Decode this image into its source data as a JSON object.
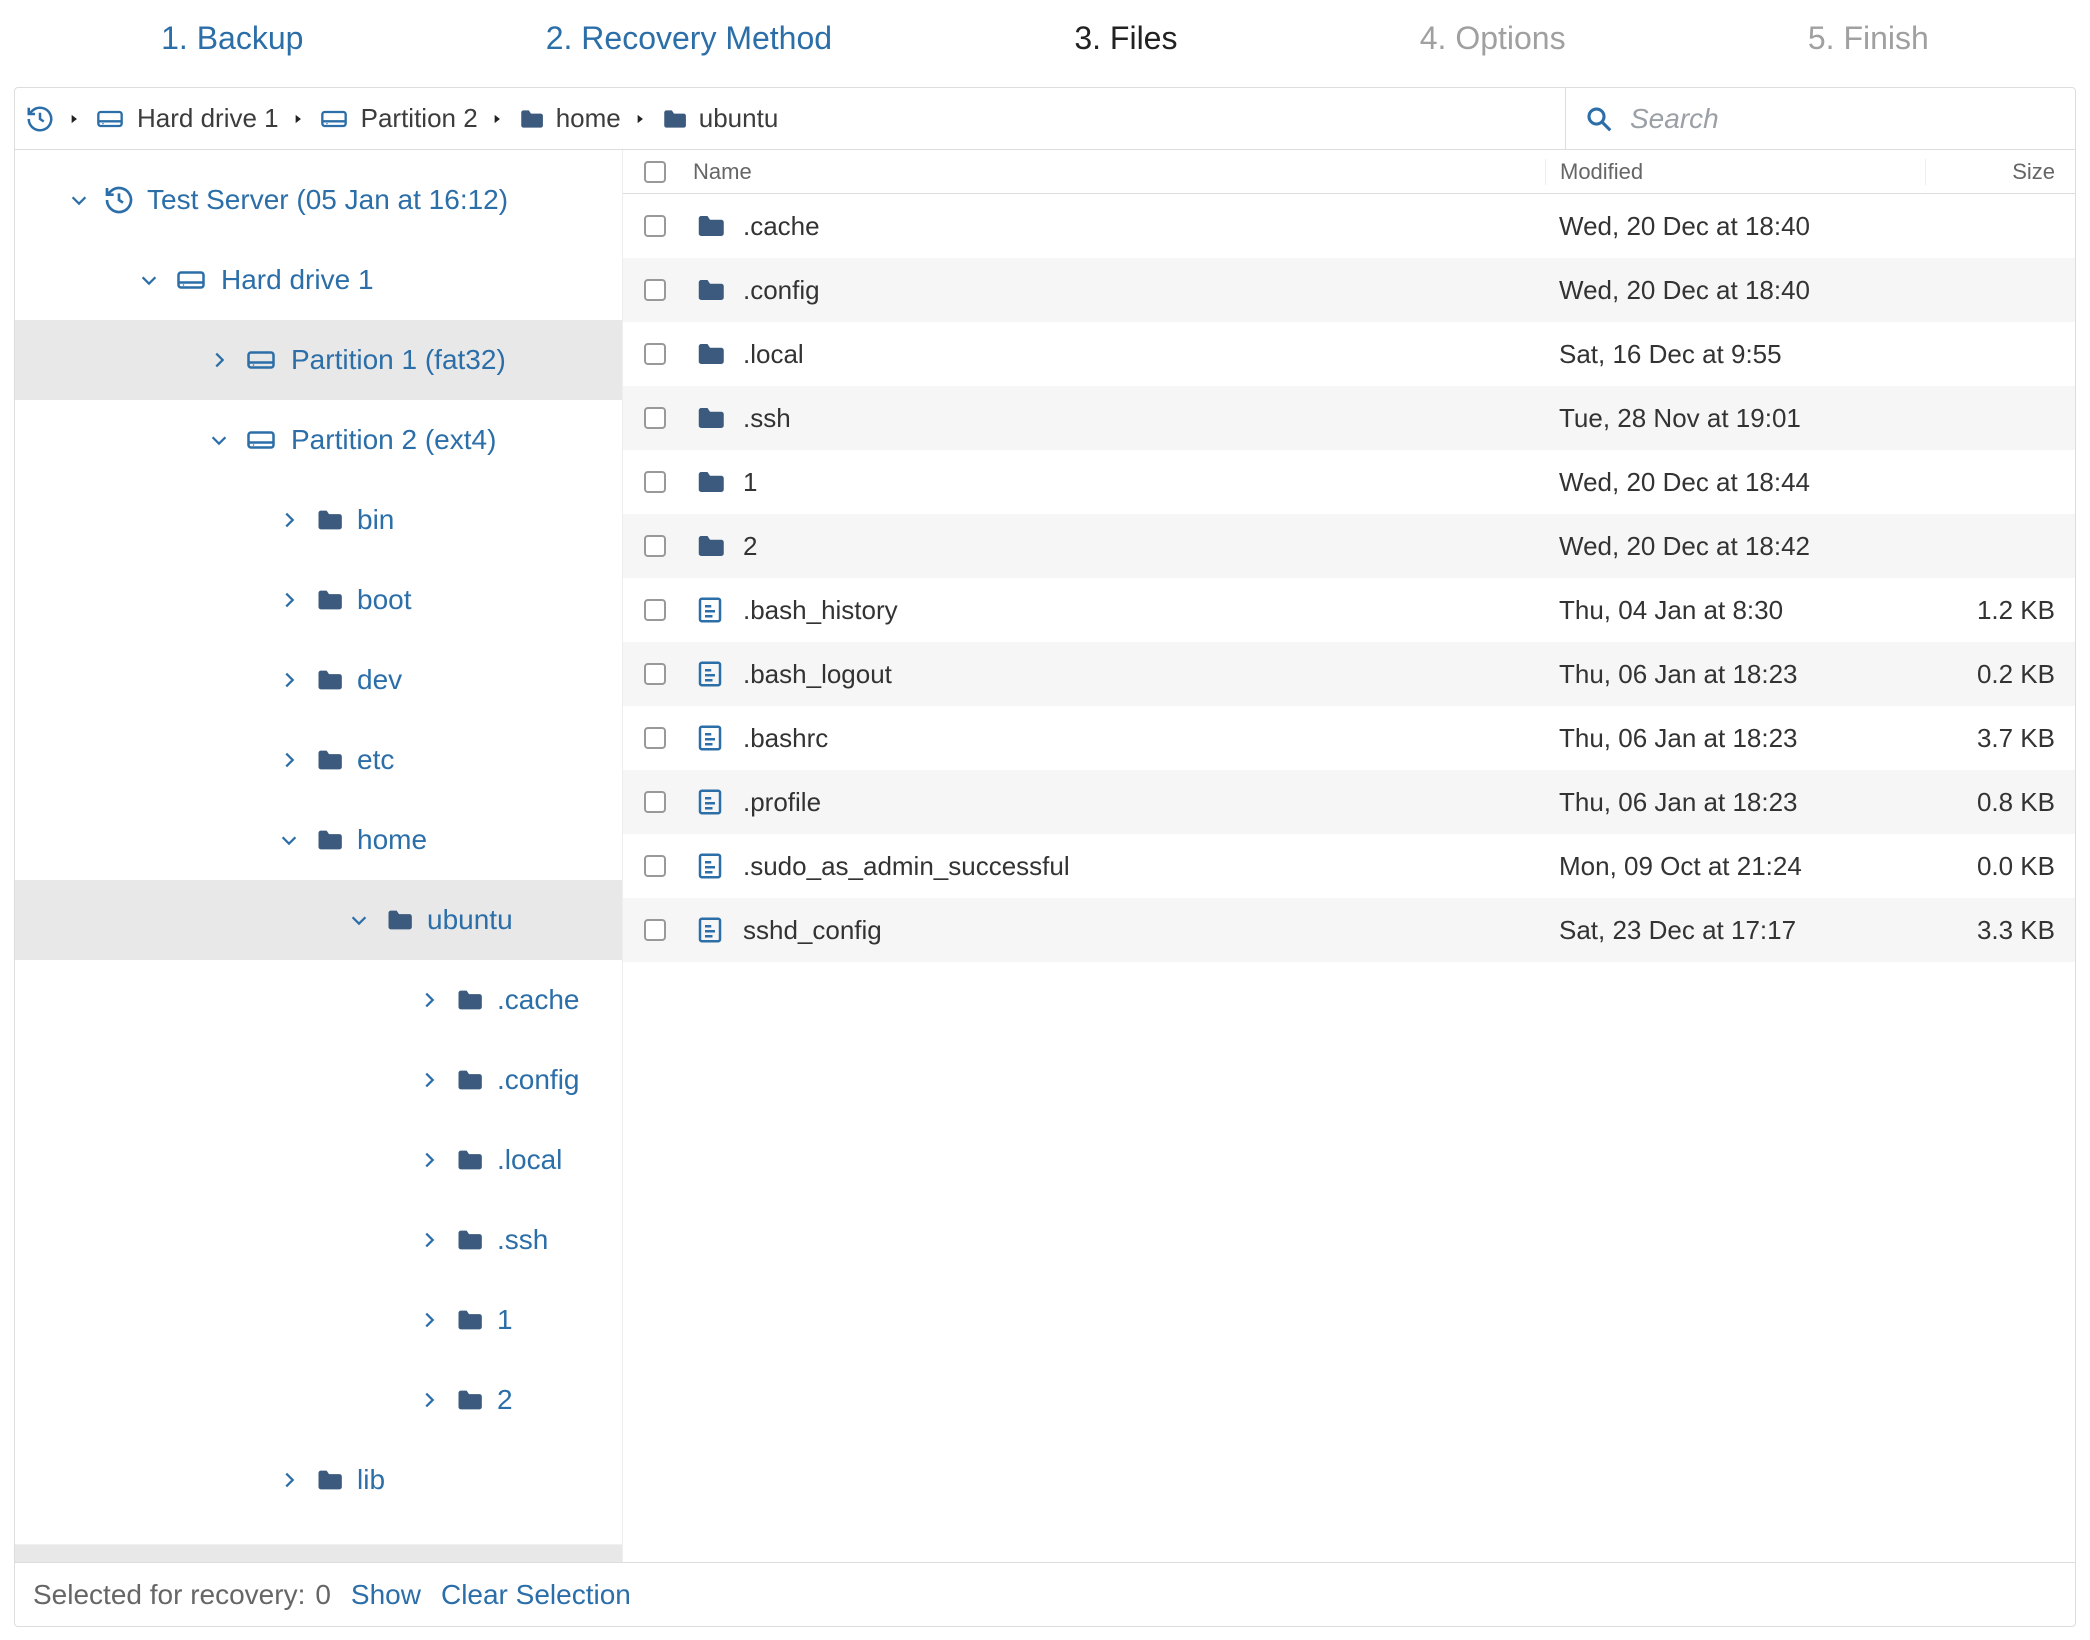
{
  "steps": {
    "s1": "1. Backup",
    "s2": "2. Recovery Method",
    "s3": "3. Files",
    "s4": "4. Options",
    "s5": "5. Finish"
  },
  "breadcrumb": {
    "b1": "Hard drive 1",
    "b2": "Partition 2",
    "b3": "home",
    "b4": "ubuntu"
  },
  "search": {
    "placeholder": "Search"
  },
  "headers": {
    "name": "Name",
    "modified": "Modified",
    "size": "Size"
  },
  "tree": {
    "root": "Test Server (05 Jan at 16:12)",
    "hd1": "Hard drive 1",
    "p1": "Partition 1 (fat32)",
    "p2": "Partition 2 (ext4)",
    "bin": "bin",
    "boot": "boot",
    "dev": "dev",
    "etc": "etc",
    "home": "home",
    "ubuntu": "ubuntu",
    "cache": ".cache",
    "config": ".config",
    "local": ".local",
    "ssh": ".ssh",
    "one": "1",
    "two": "2",
    "lib": "lib"
  },
  "files": {
    "f0": {
      "name": ".cache",
      "mod": "Wed, 20 Dec at 18:40",
      "size": "",
      "kind": "folder"
    },
    "f1": {
      "name": ".config",
      "mod": "Wed, 20 Dec at 18:40",
      "size": "",
      "kind": "folder"
    },
    "f2": {
      "name": ".local",
      "mod": "Sat, 16 Dec at 9:55",
      "size": "",
      "kind": "folder"
    },
    "f3": {
      "name": ".ssh",
      "mod": "Tue, 28 Nov at 19:01",
      "size": "",
      "kind": "folder"
    },
    "f4": {
      "name": "1",
      "mod": "Wed, 20 Dec at 18:44",
      "size": "",
      "kind": "folder"
    },
    "f5": {
      "name": "2",
      "mod": "Wed, 20 Dec at 18:42",
      "size": "",
      "kind": "folder"
    },
    "f6": {
      "name": ".bash_history",
      "mod": "Thu, 04 Jan at 8:30",
      "size": "1.2 KB",
      "kind": "file"
    },
    "f7": {
      "name": ".bash_logout",
      "mod": "Thu, 06 Jan at 18:23",
      "size": "0.2 KB",
      "kind": "file"
    },
    "f8": {
      "name": ".bashrc",
      "mod": "Thu, 06 Jan at 18:23",
      "size": "3.7 KB",
      "kind": "file"
    },
    "f9": {
      "name": ".profile",
      "mod": "Thu, 06 Jan at 18:23",
      "size": "0.8 KB",
      "kind": "file"
    },
    "f10": {
      "name": ".sudo_as_admin_successful",
      "mod": "Mon, 09 Oct at 21:24",
      "size": "0.0 KB",
      "kind": "file"
    },
    "f11": {
      "name": "sshd_config",
      "mod": "Sat, 23 Dec at 17:17",
      "size": "3.3 KB",
      "kind": "file"
    }
  },
  "footer": {
    "label": "Selected for recovery:",
    "count": "0",
    "show": "Show",
    "clear": "Clear Selection"
  }
}
